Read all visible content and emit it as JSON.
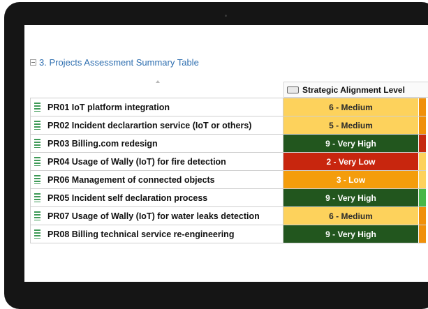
{
  "section": {
    "title": "3. Projects Assessment Summary Table"
  },
  "table": {
    "column_header": "Strategic Alignment Level",
    "rows": [
      {
        "name": "PR01 IoT platform integration",
        "level": "6 - Medium",
        "bg": "#fdd25c",
        "fg": "#2b2b2b",
        "extra": "#f0900a"
      },
      {
        "name": "PR02 Incident declarartion service (IoT or others)",
        "level": "5 - Medium",
        "bg": "#fdd25c",
        "fg": "#2b2b2b",
        "extra": "#f0900a"
      },
      {
        "name": "PR03 Billing.com redesign",
        "level": "9 - Very High",
        "bg": "#22561e",
        "fg": "#ffffff",
        "extra": "#c62a10"
      },
      {
        "name": "PR04 Usage of Wally (IoT) for fire detection",
        "level": "2 - Very Low",
        "bg": "#c8260e",
        "fg": "#ffffff",
        "extra": "#fdd25c"
      },
      {
        "name": "PR06 Management of connected objects",
        "level": "3 - Low",
        "bg": "#f49d0c",
        "fg": "#ffffff",
        "extra": "#fdd25c"
      },
      {
        "name": "PR05 Incident self declaration process",
        "level": "9 - Very High",
        "bg": "#22561e",
        "fg": "#ffffff",
        "extra": "#47b747"
      },
      {
        "name": "PR07 Usage of Wally (IoT) for water leaks detection",
        "level": "6 - Medium",
        "bg": "#fdd25c",
        "fg": "#2b2b2b",
        "extra": "#f0900a"
      },
      {
        "name": "PR08 Billing technical service re-engineering",
        "level": "9 - Very High",
        "bg": "#22561e",
        "fg": "#ffffff",
        "extra": "#f0900a"
      }
    ]
  },
  "icons": {
    "section_toggle": "collapse-icon",
    "sort": "sort-ascending-icon",
    "column": "column-header-icon",
    "row": "document-icon"
  },
  "colors": {
    "link": "#2f6fb0",
    "bezel": "#151515"
  }
}
